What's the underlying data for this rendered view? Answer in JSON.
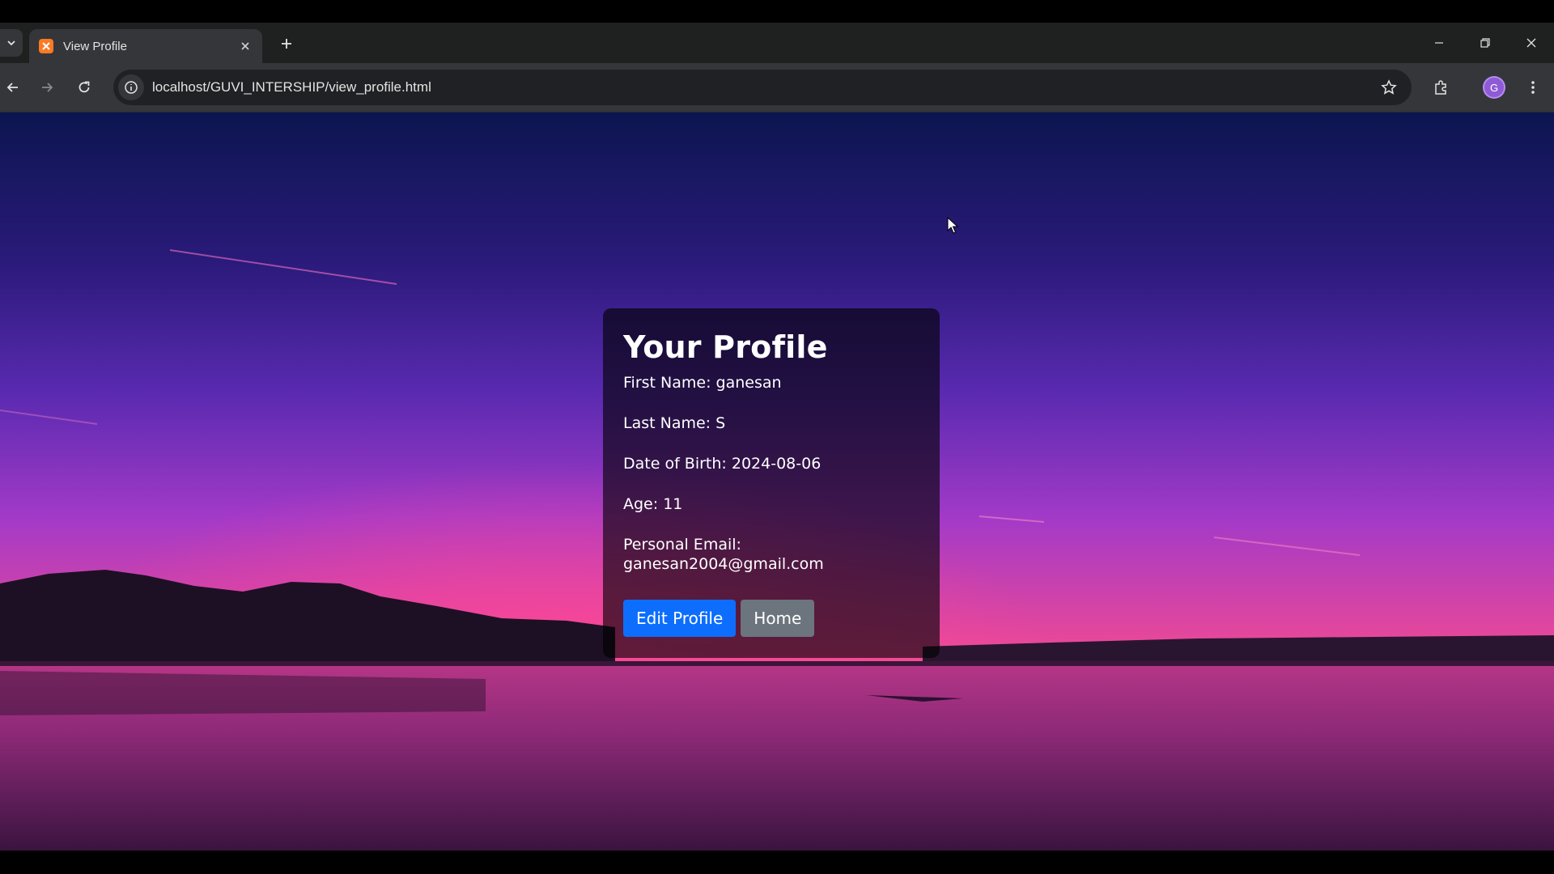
{
  "browser": {
    "tab": {
      "title": "View Profile"
    },
    "address_bar": {
      "url": "localhost/GUVI_INTERSHIP/view_profile.html"
    },
    "profile_initial": "G"
  },
  "page": {
    "card": {
      "title": "Your Profile",
      "fields": [
        "First Name: ganesan",
        "Last Name: S",
        "Date of Birth: 2024-08-06",
        "Age: 11",
        "Personal Email: ganesan2004@gmail.com"
      ],
      "buttons": {
        "edit": "Edit Profile",
        "home": "Home"
      }
    }
  },
  "colors": {
    "primary_button": "#0d6efd",
    "secondary_button": "#6c757d",
    "card_background": "rgba(0,0,0,0.62)"
  }
}
